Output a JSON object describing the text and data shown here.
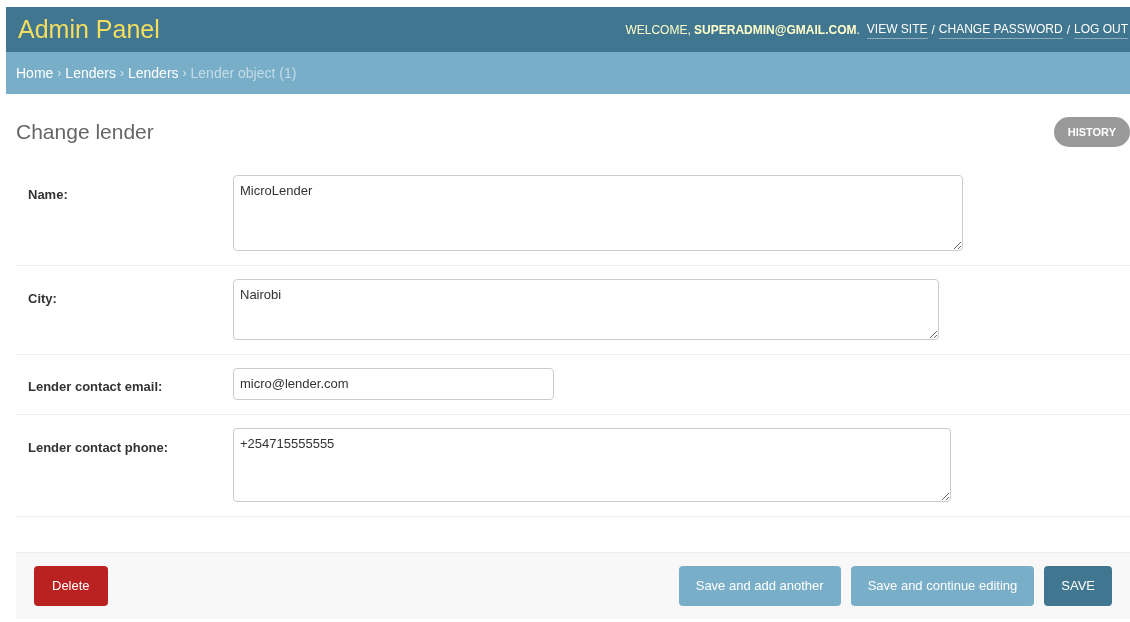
{
  "header": {
    "title": "Admin Panel",
    "welcome": "WELCOME, **SUPERADMIN@GMAIL.COM**.",
    "links": [
      "VIEW SITE",
      "CHANGE PASSWORD",
      "LOG OUT"
    ],
    "separator": "/"
  },
  "breadcrumbs": [
    {
      "label": "Home",
      "current": false
    },
    {
      "label": "Lenders",
      "current": false
    },
    {
      "label": "Lenders",
      "current": false
    },
    {
      "label": "Lender object (1)",
      "current": true
    }
  ],
  "breadcrumb_separator": "›",
  "page_title": "Change lender",
  "history_button": "HISTORY",
  "fields": [
    {
      "label": "Name:",
      "kind": "textarea",
      "value": "MicroLender"
    },
    {
      "label": "City:",
      "kind": "textarea",
      "value": "Nairobi"
    },
    {
      "label": "Lender contact email:",
      "kind": "input",
      "value": "micro@lender.com"
    },
    {
      "label": "Lender contact phone:",
      "kind": "textarea",
      "value": "+254715555555"
    }
  ],
  "buttons": [
    {
      "label": "Delete",
      "kind": "danger"
    },
    {
      "label": "Save and add another",
      "kind": "secondary"
    },
    {
      "label": "Save and continue editing",
      "kind": "secondary"
    },
    {
      "label": "SAVE",
      "kind": "primary"
    }
  ]
}
